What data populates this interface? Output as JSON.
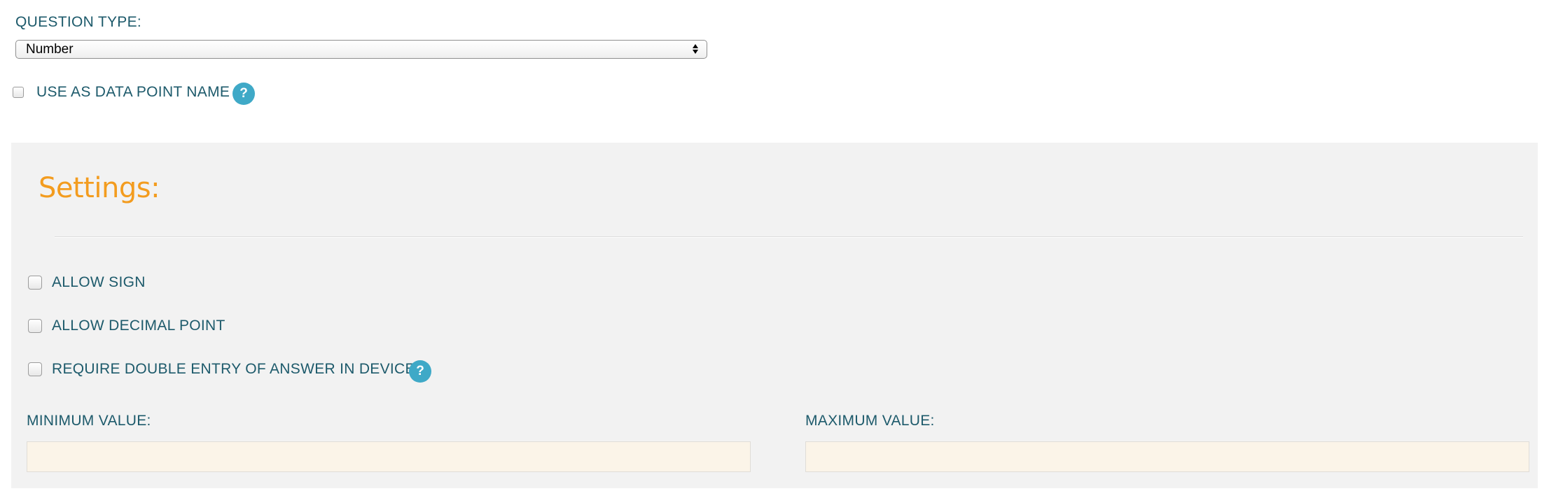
{
  "question_type": {
    "label": "QUESTION TYPE:",
    "selected": "Number"
  },
  "use_as_data_point_name": {
    "label": "USE AS DATA POINT NAME",
    "checked": false,
    "help_glyph": "?"
  },
  "settings": {
    "title": "Settings:",
    "title_color": "#f39c1f",
    "allow_sign": {
      "label": "ALLOW SIGN",
      "checked": false
    },
    "allow_decimal_point": {
      "label": "ALLOW DECIMAL POINT",
      "checked": false
    },
    "require_double_entry": {
      "label": "REQUIRE DOUBLE ENTRY OF ANSWER IN DEVICE",
      "checked": false,
      "help_glyph": "?"
    },
    "minimum_value": {
      "label": "MINIMUM VALUE:",
      "value": ""
    },
    "maximum_value": {
      "label": "MAXIMUM VALUE:",
      "value": ""
    }
  },
  "colors": {
    "label_text": "#1d5a6b",
    "help_badge": "#3fa9c7",
    "panel_bg": "#f2f2f2",
    "input_bg": "#fbf4e8"
  }
}
